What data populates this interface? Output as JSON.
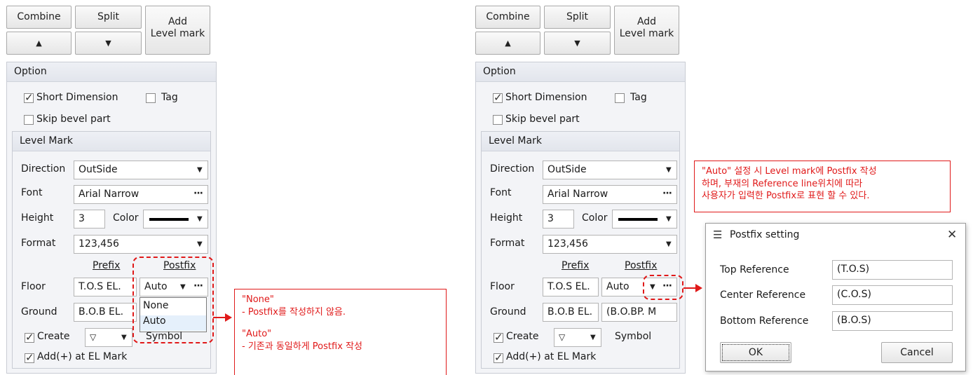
{
  "left": {
    "buttons": {
      "combine": "Combine",
      "split": "Split",
      "add_level_mark": "Add\nLevel mark",
      "up": "▲",
      "down": "▼"
    },
    "option": {
      "title": "Option",
      "short_dimension": "Short Dimension",
      "tag": "Tag",
      "skip_bevel": "Skip bevel part"
    },
    "level_mark": {
      "title": "Level Mark",
      "direction_label": "Direction",
      "direction_value": "OutSide",
      "font_label": "Font",
      "font_value": "Arial Narrow",
      "height_label": "Height",
      "height_value": "3",
      "color_label": "Color",
      "format_label": "Format",
      "format_value": "123,456",
      "prefix_header": "Prefix",
      "postfix_header": "Postfix",
      "floor_label": "Floor",
      "floor_prefix": "T.O.S EL.",
      "floor_postfix": "Auto",
      "ground_label": "Ground",
      "ground_prefix": "B.O.B EL.",
      "dropdown_options": [
        "None",
        "Auto"
      ],
      "create_label": "Create",
      "symbol_value": "▽",
      "symbol_label": "Symbol",
      "add_plus": "Add(+) at EL Mark"
    },
    "callout": [
      "\"None\"",
      "- Postfix를 작성하지 않음.",
      "",
      "\"Auto\"",
      "- 기존과 동일하게 Postfix 작성"
    ]
  },
  "right": {
    "buttons": {
      "combine": "Combine",
      "split": "Split",
      "add_level_mark": "Add\nLevel mark",
      "up": "▲",
      "down": "▼"
    },
    "option": {
      "title": "Option",
      "short_dimension": "Short Dimension",
      "tag": "Tag",
      "skip_bevel": "Skip bevel part"
    },
    "level_mark": {
      "title": "Level Mark",
      "direction_label": "Direction",
      "direction_value": "OutSide",
      "font_label": "Font",
      "font_value": "Arial Narrow",
      "height_label": "Height",
      "height_value": "3",
      "color_label": "Color",
      "format_label": "Format",
      "format_value": "123,456",
      "prefix_header": "Prefix",
      "postfix_header": "Postfix",
      "floor_label": "Floor",
      "floor_prefix": "T.O.S EL.",
      "floor_postfix": "Auto",
      "ground_label": "Ground",
      "ground_prefix": "B.O.B EL.",
      "ground_postfix": "(B.O.BP. M",
      "create_label": "Create",
      "symbol_value": "▽",
      "symbol_label": "Symbol",
      "add_plus": "Add(+) at EL Mark"
    },
    "callout": [
      "\"Auto\" 설정 시 Level mark에  Postfix 작성",
      "하며, 부재의 Reference line위치에 따라",
      "사용자가 입력한 Postfix로 표현 할 수 있다."
    ],
    "dialog": {
      "title": "Postfix setting",
      "close": "✕",
      "top_label": "Top Reference",
      "top_value": "(T.O.S)",
      "center_label": "Center Reference",
      "center_value": "(C.O.S)",
      "bottom_label": "Bottom Reference",
      "bottom_value": "(B.O.S)",
      "ok": "OK",
      "cancel": "Cancel"
    }
  },
  "colors": {
    "annotation_red": "#e01919",
    "group_bg": "#f3f4f7"
  }
}
